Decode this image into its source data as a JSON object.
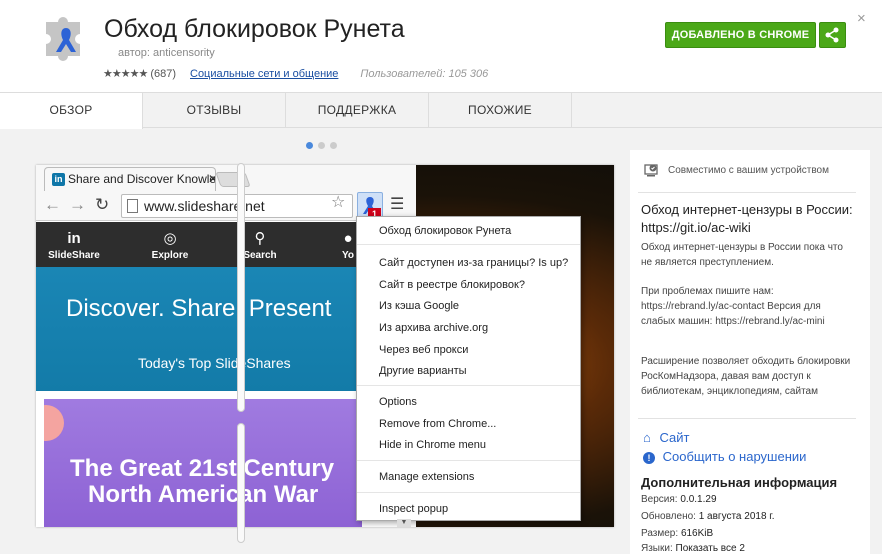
{
  "header": {
    "title": "Обход блокировок Рунета",
    "author": "автор: anticensority",
    "stars": "★★★★★",
    "rating_count": "(687)",
    "category": "Социальные сети и общение",
    "users": "Пользователей: 105 306",
    "add_button": "ДОБАВЛЕНО В CHROME",
    "close": "×"
  },
  "tabs": [
    "ОБЗОР",
    "ОТЗЫВЫ",
    "ПОДДЕРЖКА",
    "ПОХОЖИЕ"
  ],
  "screenshot": {
    "tab_title": "Share and Discover Knowle",
    "tab_close": "✕",
    "url": "www.slideshare.net",
    "badge": "1",
    "nav": [
      {
        "icon": "in",
        "label": "SlideShare"
      },
      {
        "icon": "◎",
        "label": "Explore"
      },
      {
        "icon": "⚲",
        "label": "Search"
      },
      {
        "icon": "●",
        "label": "Yo"
      }
    ],
    "hero_heading": "Discover. Share. Present",
    "hero_sub": "Today's Top SlideShares",
    "card_line1": "The Great 21st Century",
    "card_line2": "North American War",
    "popup": {
      "title": "Обход блокировок Рунета",
      "group1": [
        "Сайт доступен из-за границы? Is up?",
        "Сайт в реестре блокировок?",
        "Из кэша Google",
        "Из архива archive.org",
        "Через веб прокси",
        "Другие варианты"
      ],
      "group2": [
        "Options",
        "Remove from Chrome...",
        "Hide in Chrome menu"
      ],
      "group3": [
        "Manage extensions"
      ],
      "group4": [
        "Inspect popup"
      ]
    }
  },
  "sidebar": {
    "compat": "Совместимо с вашим устройством",
    "desc_title": "Обход интернет-цензуры в России: https://git.io/ac-wiki",
    "p1": "Обход интернет-цензуры в России пока что не является преступлением.",
    "p2": "При проблемах пишите нам: https://rebrand.ly/ac-contact Версия для слабых машин: https://rebrand.ly/ac-mini",
    "p3": "Расширение позволяет обходить блокировки РосКомНадзора, давая вам доступ к библиотекам, энциклопедиям, сайтам",
    "site_link": "Сайт",
    "report_link": "Сообщить о нарушении",
    "add_info_title": "Дополнительная информация",
    "version_label": "Версия:",
    "version": "0.0.1.29",
    "updated_label": "Обновлено:",
    "updated": "1 августа 2018 г.",
    "size_label": "Размер:",
    "size": "616KiB",
    "langs_label": "Языки:",
    "langs": "Показать все 2"
  },
  "colors": {
    "add_green": "#4ba818",
    "link_blue": "#2a66cc",
    "dot_active": "#4a89dc"
  }
}
